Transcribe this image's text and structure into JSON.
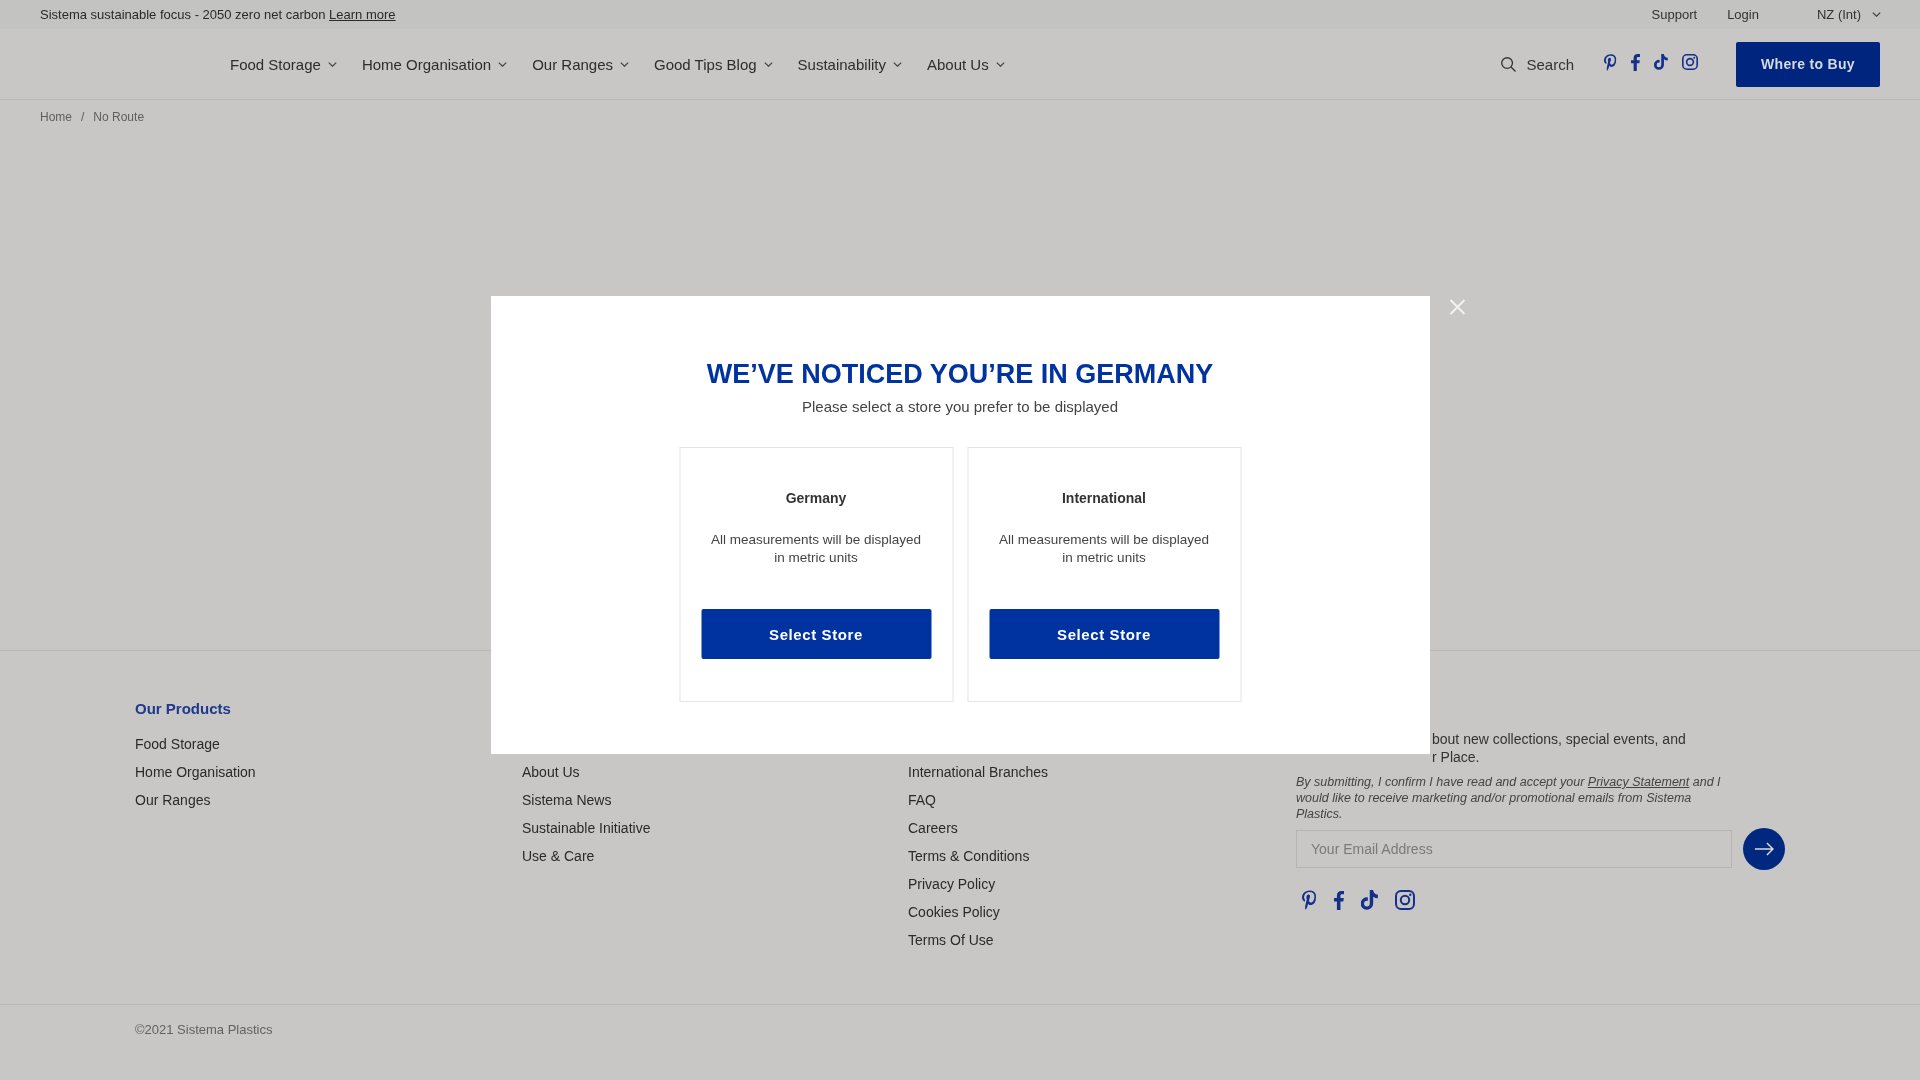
{
  "top_bar": {
    "message": "Sistema sustainable focus - 2050 zero net carbon",
    "link": "Learn more",
    "links": [
      "Support",
      "Login"
    ],
    "region": "NZ (Int)"
  },
  "nav": {
    "items": [
      "Food Storage",
      "Home Organisation",
      "Our Ranges",
      "Good Tips Blog",
      "Sustainability",
      "About Us"
    ],
    "search": "Search",
    "button": "Where to Buy"
  },
  "breadcrumb": {
    "items": [
      "Home",
      "No Route"
    ],
    "separator": "/"
  },
  "footer": {
    "columns": [
      {
        "heading": "Our Products",
        "links": [
          "Food Storage",
          "Home Organisation",
          "Our Ranges"
        ]
      },
      {
        "links": [
          "About Us",
          "Sistema News",
          "Sustainable Initiative",
          "Use & Care"
        ]
      },
      {
        "links": [
          "International Branches",
          "FAQ",
          "Careers",
          "Terms & Conditions",
          "Privacy Policy",
          "Cookies Policy",
          "Terms Of Use"
        ]
      }
    ],
    "newsletter": {
      "intro_lines": [
        "bout new collections, special events, and",
        "r Place."
      ],
      "consent": {
        "before": "By submitting, I confirm I have read and accept your",
        "link": "Privacy Statement",
        "after": "and I would like to receive marketing and/or promotional emails from Sistema Plastics."
      },
      "email": {
        "placeholder": "Your Email Address"
      }
    },
    "copyright": "©2021 Sistema Plastics"
  },
  "modal": {
    "title": "WE’VE NOTICED YOU’RE IN GERMANY",
    "subtitle": "Please select a store you prefer to be displayed",
    "stores": [
      {
        "name": "Germany",
        "description": "All measurements will be displayed in metric units",
        "button": "Select Store"
      },
      {
        "name": "International",
        "description": "All measurements will be displayed in metric units",
        "button": "Select Store"
      }
    ]
  }
}
